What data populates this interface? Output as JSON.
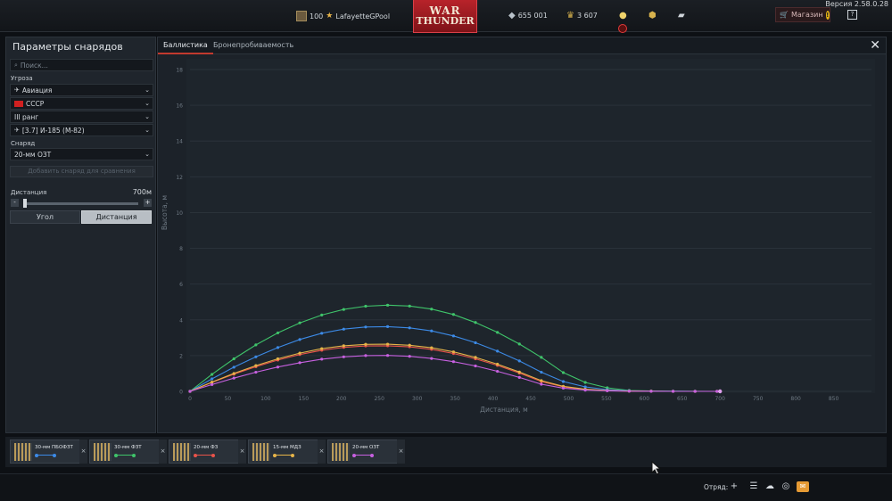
{
  "header": {
    "version": "Версия 2.58.0.28",
    "level": "100",
    "username": "LafayetteGPool",
    "logo_line1": "WAR",
    "logo_line2": "THUNDER",
    "silver_lions": "655 001",
    "golden_eagles": "3 607",
    "shop_label": "Магазин",
    "shop_badge": "!",
    "help_label": "?",
    "colors": {
      "accent_red": "#b8232a"
    }
  },
  "left_panel": {
    "title": "Параметры снарядов",
    "search_placeholder": "Поиск...",
    "threat_label": "Угроза",
    "threat_values": [
      "Авиация",
      "СССР",
      "III ранг",
      "[3.7] И-185 (М-82)"
    ],
    "shell_label": "Снаряд",
    "shell_value": "20-мм ОЗТ",
    "add_shell_label": "Добавить снаряд для сравнения",
    "distance_label": "Дистанция",
    "distance_value": "700м",
    "slider_minus": "-",
    "slider_plus": "+",
    "btn_angle": "Угол",
    "btn_distance": "Дистанция"
  },
  "main": {
    "tabs": [
      "Баллистика",
      "Бронепробиваемость"
    ],
    "close_label": "✕"
  },
  "chart_data": {
    "type": "line",
    "xlabel": "Дистанция, м",
    "ylabel": "Высота, м",
    "xlim": [
      0,
      900
    ],
    "ylim": [
      0,
      18
    ],
    "x_ticks": [
      0,
      50,
      100,
      150,
      200,
      250,
      300,
      350,
      400,
      450,
      500,
      550,
      600,
      650,
      700,
      750,
      800,
      850
    ],
    "y_ticks": [
      0,
      2,
      4,
      6,
      8,
      10,
      12,
      14,
      16,
      18
    ],
    "grid": true,
    "series": [
      {
        "color": "#3fc46a",
        "x": [
          0,
          29,
          58,
          87,
          116,
          145,
          174,
          203,
          232,
          261,
          290,
          319,
          348,
          377,
          406,
          435,
          464,
          493,
          522,
          551,
          580,
          609,
          638,
          667,
          696,
          700
        ],
        "y": [
          0,
          0.95,
          1.82,
          2.6,
          3.27,
          3.83,
          4.27,
          4.58,
          4.76,
          4.82,
          4.77,
          4.6,
          4.3,
          3.85,
          3.3,
          2.65,
          1.9,
          1.05,
          0.5,
          0.2,
          0.05,
          0.02,
          0.01,
          0.005,
          0.002,
          0
        ]
      },
      {
        "color": "#3c8ae6",
        "x": [
          0,
          29,
          58,
          87,
          116,
          145,
          174,
          203,
          232,
          261,
          290,
          319,
          348,
          377,
          406,
          435,
          464,
          493,
          522,
          551,
          580,
          609,
          638,
          667,
          696,
          700
        ],
        "y": [
          0,
          0.7,
          1.35,
          1.93,
          2.45,
          2.9,
          3.25,
          3.48,
          3.6,
          3.62,
          3.55,
          3.38,
          3.1,
          2.72,
          2.25,
          1.7,
          1.07,
          0.55,
          0.25,
          0.1,
          0.03,
          0.01,
          0.005,
          0.002,
          0.001,
          0
        ]
      },
      {
        "color": "#e8534a",
        "x": [
          0,
          29,
          58,
          87,
          116,
          145,
          174,
          203,
          232,
          261,
          290,
          319,
          348,
          377,
          406,
          435,
          464,
          493,
          522,
          551,
          580,
          609,
          638,
          667,
          696,
          700
        ],
        "y": [
          0,
          0.5,
          0.96,
          1.38,
          1.75,
          2.06,
          2.3,
          2.46,
          2.54,
          2.55,
          2.49,
          2.35,
          2.12,
          1.82,
          1.45,
          1.02,
          0.55,
          0.25,
          0.1,
          0.04,
          0.01,
          0.005,
          0.002,
          0.001,
          0.0005,
          0
        ]
      },
      {
        "color": "#e6b449",
        "x": [
          0,
          29,
          58,
          87,
          116,
          145,
          174,
          203,
          232,
          261,
          290,
          319,
          348,
          377,
          406,
          435,
          464,
          493,
          522,
          551,
          580,
          609,
          638,
          667,
          696,
          700
        ],
        "y": [
          0,
          0.52,
          1.0,
          1.44,
          1.82,
          2.14,
          2.39,
          2.55,
          2.63,
          2.64,
          2.58,
          2.44,
          2.21,
          1.9,
          1.52,
          1.08,
          0.6,
          0.28,
          0.12,
          0.05,
          0.015,
          0.006,
          0.002,
          0.001,
          0.0005,
          0
        ]
      },
      {
        "color": "#c760e0",
        "x": [
          0,
          29,
          58,
          87,
          116,
          145,
          174,
          203,
          232,
          261,
          290,
          319,
          348,
          377,
          406,
          435,
          464,
          493,
          522,
          551,
          580,
          609,
          638,
          667,
          696,
          700
        ],
        "y": [
          0,
          0.38,
          0.74,
          1.07,
          1.36,
          1.6,
          1.8,
          1.93,
          2.0,
          2.01,
          1.96,
          1.84,
          1.66,
          1.42,
          1.12,
          0.78,
          0.4,
          0.18,
          0.07,
          0.03,
          0.01,
          0.004,
          0.0015,
          0.0007,
          0.0003,
          0
        ]
      }
    ]
  },
  "slots": [
    {
      "name": "30-мм ПБОФЗТ",
      "color": "#3c8ae6"
    },
    {
      "name": "30-мм ФЗТ",
      "color": "#3fc46a"
    },
    {
      "name": "20-мм ФЗ",
      "color": "#e8534a"
    },
    {
      "name": "15-мм МДЗ",
      "color": "#e6b449"
    },
    {
      "name": "20-мм ОЗТ",
      "color": "#c760e0"
    }
  ],
  "slot_remove_label": "×",
  "footer": {
    "squad_label": "Отряд:",
    "add_label": "+"
  }
}
